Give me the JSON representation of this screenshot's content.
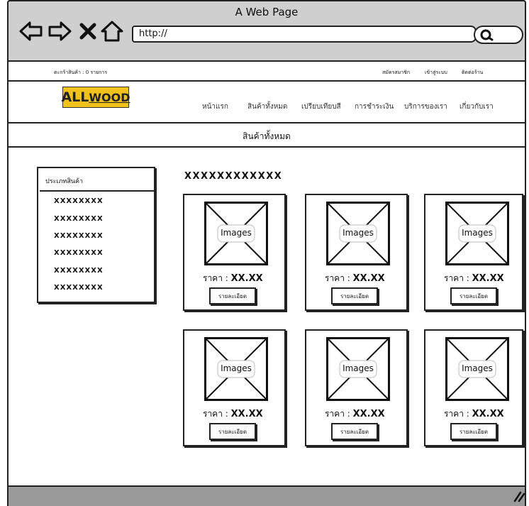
{
  "window": {
    "title": "A Web Page",
    "url": "http://"
  },
  "topbar": {
    "cart_text": "ตะกร้าสินค้า : 0 รายการ",
    "links": [
      "สมัครสมาชิก",
      "เข้าสู่ระบบ",
      "ติดต่อร้าน"
    ]
  },
  "brand": {
    "logo_prefix": "ALL",
    "logo_suffix": "WOOD",
    "color": "#f1c21b"
  },
  "nav": [
    "หน้าแรก",
    "สินค้าทั้งหมด",
    "เปรียบเทียบสี",
    "การชำระเงิน",
    "บริการของเรา",
    "เกี่ยวกับเรา"
  ],
  "page_title": "สินค้าทั้งหมด",
  "sidebar": {
    "heading": "ประเภทสินค้า",
    "items": [
      "XXXXXXXX",
      "XXXXXXXX",
      "XXXXXXXX",
      "XXXXXXXX",
      "XXXXXXXX",
      "XXXXXXXX"
    ]
  },
  "section_heading": "XXXXXXXXXXXX",
  "products": [
    {
      "image_label": "Images",
      "price_label": "ราคา :",
      "price": "XX.XX",
      "detail_label": "รายละเอียด"
    },
    {
      "image_label": "Images",
      "price_label": "ราคา :",
      "price": "XX.XX",
      "detail_label": "รายละเอียด"
    },
    {
      "image_label": "Images",
      "price_label": "ราคา :",
      "price": "XX.XX",
      "detail_label": "รายละเอียด"
    },
    {
      "image_label": "Images",
      "price_label": "ราคา :",
      "price": "XX.XX",
      "detail_label": "รายละเอียด"
    },
    {
      "image_label": "Images",
      "price_label": "ราคา :",
      "price": "XX.XX",
      "detail_label": "รายละเอียด"
    },
    {
      "image_label": "Images",
      "price_label": "ราคา :",
      "price": "XX.XX",
      "detail_label": "รายละเอียด"
    }
  ],
  "icons": [
    "back-icon",
    "forward-icon",
    "close-icon",
    "home-icon",
    "search-icon",
    "resize-grip-icon"
  ]
}
